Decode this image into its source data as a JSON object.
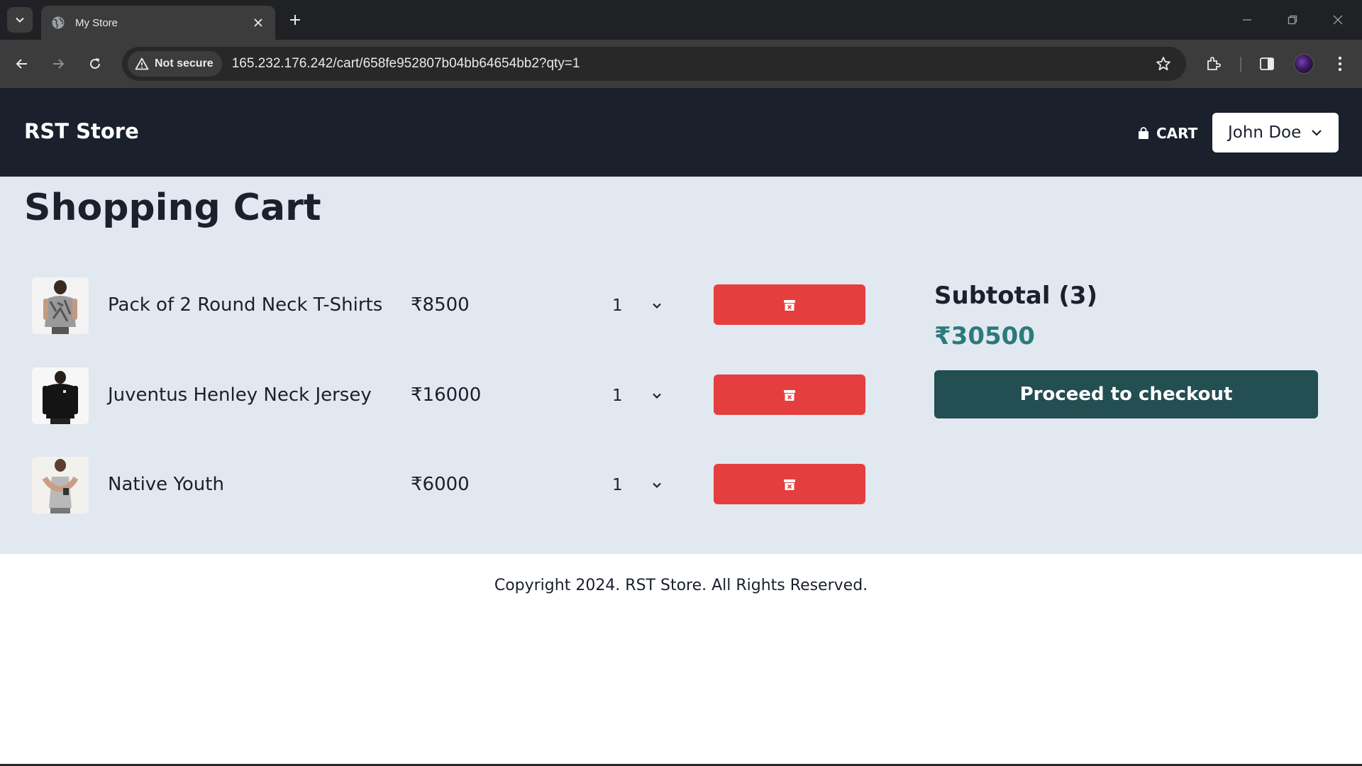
{
  "browser": {
    "tab_title": "My Store",
    "security_label": "Not secure",
    "url": "165.232.176.242/cart/658fe952807b04bb64654bb2?qty=1"
  },
  "navbar": {
    "brand": "RST Store",
    "cart_label": "CART",
    "user_name": "John Doe"
  },
  "cart": {
    "heading": "Shopping Cart",
    "items": [
      {
        "name": "Pack of 2 Round Neck T-Shirts",
        "price": "₹8500",
        "qty": "1"
      },
      {
        "name": "Juventus Henley Neck Jersey",
        "price": "₹16000",
        "qty": "1"
      },
      {
        "name": "Native Youth",
        "price": "₹6000",
        "qty": "1"
      }
    ],
    "subtotal_title": "Subtotal (3)",
    "subtotal_amount": "₹30500",
    "checkout_label": "Proceed to checkout"
  },
  "footer": {
    "copyright": "Copyright 2024. RST Store. All Rights Reserved."
  },
  "colors": {
    "navbar_bg": "#1a202c",
    "main_bg": "#e2e8f0",
    "delete_red": "#e53e3e",
    "checkout_teal": "#234e52",
    "subtotal_teal": "#2c7a7b"
  }
}
